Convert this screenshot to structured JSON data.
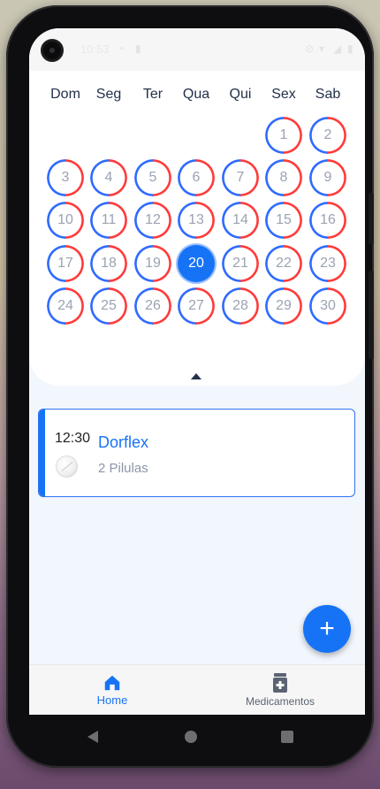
{
  "status_bar": {
    "time": "10:53"
  },
  "calendar": {
    "weekdays": [
      "Dom",
      "Seg",
      "Ter",
      "Qua",
      "Qui",
      "Sex",
      "Sab"
    ],
    "days": [
      "1",
      "2",
      "3",
      "4",
      "5",
      "6",
      "7",
      "8",
      "9",
      "10",
      "11",
      "12",
      "13",
      "14",
      "15",
      "16",
      "17",
      "18",
      "19",
      "20",
      "21",
      "22",
      "23",
      "24",
      "25",
      "26",
      "27",
      "28",
      "29",
      "30"
    ],
    "selected_day": "20",
    "colors": {
      "selected": "#1773f6",
      "ring_left": "#ff3b3b",
      "ring_right": "#2f6bff"
    }
  },
  "medication": {
    "time": "12:30",
    "name": "Dorflex",
    "dose": "2 Pilulas"
  },
  "fab": {
    "label": "+"
  },
  "bottom_nav": [
    {
      "label": "Home",
      "icon": "home-icon",
      "active": true
    },
    {
      "label": "Medicamentos",
      "icon": "medicine-bottle-icon",
      "active": false
    }
  ]
}
